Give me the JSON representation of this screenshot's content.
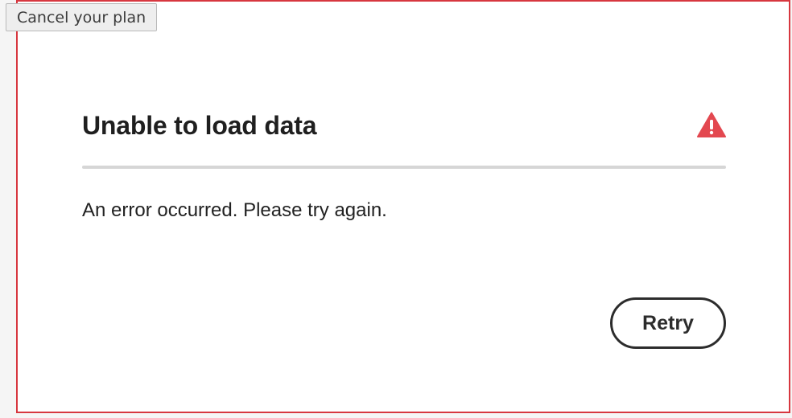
{
  "tooltip": {
    "text": "Cancel your plan"
  },
  "dialog": {
    "title": "Unable to load data",
    "message": "An error occurred. Please try again.",
    "retry_label": "Retry",
    "alert_icon": "alert-triangle-icon"
  },
  "colors": {
    "frame_border": "#d7373f",
    "alert": "#e34850",
    "divider": "#d6d6d6",
    "button_border": "#2c2c2c"
  }
}
